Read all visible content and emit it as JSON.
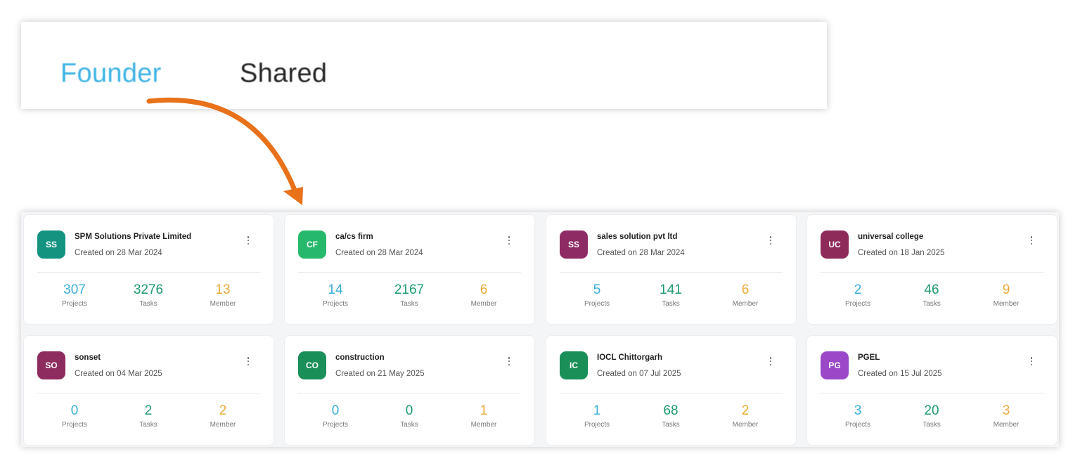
{
  "tabs": [
    {
      "label": "Founder",
      "active": true,
      "color": "#3fb4e4"
    },
    {
      "label": "Shared",
      "active": false,
      "color": "#262626"
    }
  ],
  "arrow_color": "#e8711a",
  "stat_colors": {
    "projects": "#3aaed8",
    "tasks": "#1e9a6c",
    "members": "#e9a93a"
  },
  "cards": [
    {
      "initials": "SS",
      "avatar_color": "#159381",
      "title": "SPM Solutions Private Limited",
      "created": "Created on 28 Mar 2024",
      "projects": "307",
      "projects_label": "Projects",
      "tasks": "3276",
      "tasks_label": "Tasks",
      "members": "13",
      "members_label": "Member"
    },
    {
      "initials": "CF",
      "avatar_color": "#26b96c",
      "title": "ca/cs firm",
      "created": "Created on 28 Mar 2024",
      "projects": "14",
      "projects_label": "Projects",
      "tasks": "2167",
      "tasks_label": "Tasks",
      "members": "6",
      "members_label": "Member"
    },
    {
      "initials": "SS",
      "avatar_color": "#8e2b64",
      "title": "sales solution pvt ltd",
      "created": "Created on 28 Mar 2024",
      "projects": "5",
      "projects_label": "Projects",
      "tasks": "141",
      "tasks_label": "Tasks",
      "members": "6",
      "members_label": "Member"
    },
    {
      "initials": "UC",
      "avatar_color": "#8e2b5a",
      "title": "universal college",
      "created": "Created on 18 Jan 2025",
      "projects": "2",
      "projects_label": "Projects",
      "tasks": "46",
      "tasks_label": "Tasks",
      "members": "9",
      "members_label": "Member"
    },
    {
      "initials": "SO",
      "avatar_color": "#8e2b5f",
      "title": "sonset",
      "created": "Created on 04 Mar 2025",
      "projects": "0",
      "projects_label": "Projects",
      "tasks": "2",
      "tasks_label": "Tasks",
      "members": "2",
      "members_label": "Member"
    },
    {
      "initials": "CO",
      "avatar_color": "#1b8f58",
      "title": "construction",
      "created": "Created on 21 May 2025",
      "projects": "0",
      "projects_label": "Projects",
      "tasks": "0",
      "tasks_label": "Tasks",
      "members": "1",
      "members_label": "Member"
    },
    {
      "initials": "IC",
      "avatar_color": "#1b8f58",
      "title": "IOCL Chittorgarh",
      "created": "Created on 07 Jul 2025",
      "projects": "1",
      "projects_label": "Projects",
      "tasks": "68",
      "tasks_label": "Tasks",
      "members": "2",
      "members_label": "Member"
    },
    {
      "initials": "PG",
      "avatar_color": "#9a48c8",
      "title": "PGEL",
      "created": "Created on 15 Jul 2025",
      "projects": "3",
      "projects_label": "Projects",
      "tasks": "20",
      "tasks_label": "Tasks",
      "members": "3",
      "members_label": "Member"
    }
  ]
}
